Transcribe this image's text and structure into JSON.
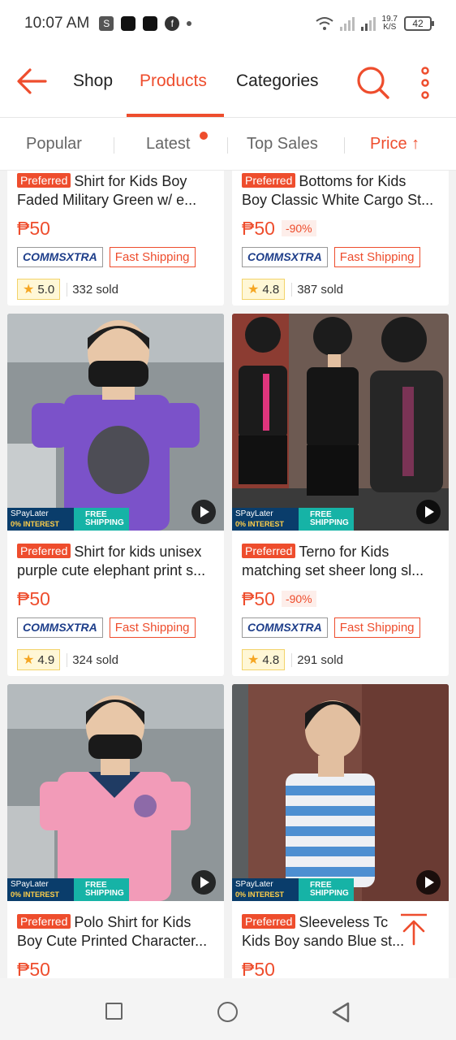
{
  "status_bar": {
    "time": "10:07 AM",
    "net_speed_value": "19.7",
    "net_speed_unit": "K/S",
    "battery": "42"
  },
  "header": {
    "tabs": [
      {
        "label": "Shop"
      },
      {
        "label": "Products",
        "active": true
      },
      {
        "label": "Categories"
      }
    ],
    "icons": [
      "back-arrow-icon",
      "search-icon",
      "more-vertical-icon"
    ],
    "accent_color": "#ee4d2d"
  },
  "sort_bar": {
    "options": [
      {
        "label": "Popular"
      },
      {
        "label": "Latest",
        "has_dot": true
      },
      {
        "label": "Top Sales"
      },
      {
        "label": "Price ↑",
        "active": true
      }
    ]
  },
  "products": [
    {
      "badge": "Preferred",
      "title_line1": "Shirt for Kids Boy",
      "title_line2": "Faded Military Green w/ e...",
      "price": "₱50",
      "discount": "",
      "tag_comms_a": "COMMS",
      "tag_comms_b": "XTRA",
      "tag_shipping": "Fast Shipping",
      "rating": "5.0",
      "sold": "332 sold"
    },
    {
      "badge": "Preferred",
      "title_line1": "Bottoms for Kids",
      "title_line2": "Boy Classic White Cargo St...",
      "price": "₱50",
      "discount": "-90%",
      "tag_comms_a": "COMMS",
      "tag_comms_b": "XTRA",
      "tag_shipping": "Fast Shipping",
      "rating": "4.8",
      "sold": "387 sold"
    },
    {
      "badge": "Preferred",
      "title_line1": "Shirt for kids unisex",
      "title_line2": "purple cute elephant print s...",
      "price": "₱50",
      "discount": "",
      "tag_comms_a": "COMMS",
      "tag_comms_b": "XTRA",
      "tag_shipping": "Fast Shipping",
      "rating": "4.9",
      "sold": "324 sold",
      "image_labels": {
        "spay": "SPayLater",
        "interest": "0% INTEREST",
        "free": "FREE",
        "shipping": "SHIPPING"
      }
    },
    {
      "badge": "Preferred",
      "title_line1": "Terno for Kids",
      "title_line2": "matching set sheer long sl...",
      "price": "₱50",
      "discount": "-90%",
      "tag_comms_a": "COMMS",
      "tag_comms_b": "XTRA",
      "tag_shipping": "Fast Shipping",
      "rating": "4.8",
      "sold": "291 sold",
      "image_labels": {
        "spay": "SPayLater",
        "interest": "0% INTEREST",
        "free": "FREE",
        "shipping": "SHIPPING"
      }
    },
    {
      "badge": "Preferred",
      "title_line1": "Polo Shirt for Kids",
      "title_line2": "Boy Cute Printed Character...",
      "price": "₱50",
      "image_labels": {
        "spay": "SPayLater",
        "interest": "0% INTEREST",
        "free": "FREE",
        "shipping": "SHIPPING"
      }
    },
    {
      "badge": "Preferred",
      "title_line1": "Sleeveless Tc",
      "title_line2": "Kids Boy sando Blue st...",
      "price": "₱50",
      "image_labels": {
        "spay": "SPayLater",
        "interest": "0% INTEREST",
        "free": "FREE",
        "shipping": "SHIPPING"
      }
    }
  ],
  "system_nav": [
    "recents-square-icon",
    "home-circle-icon",
    "back-triangle-icon"
  ]
}
